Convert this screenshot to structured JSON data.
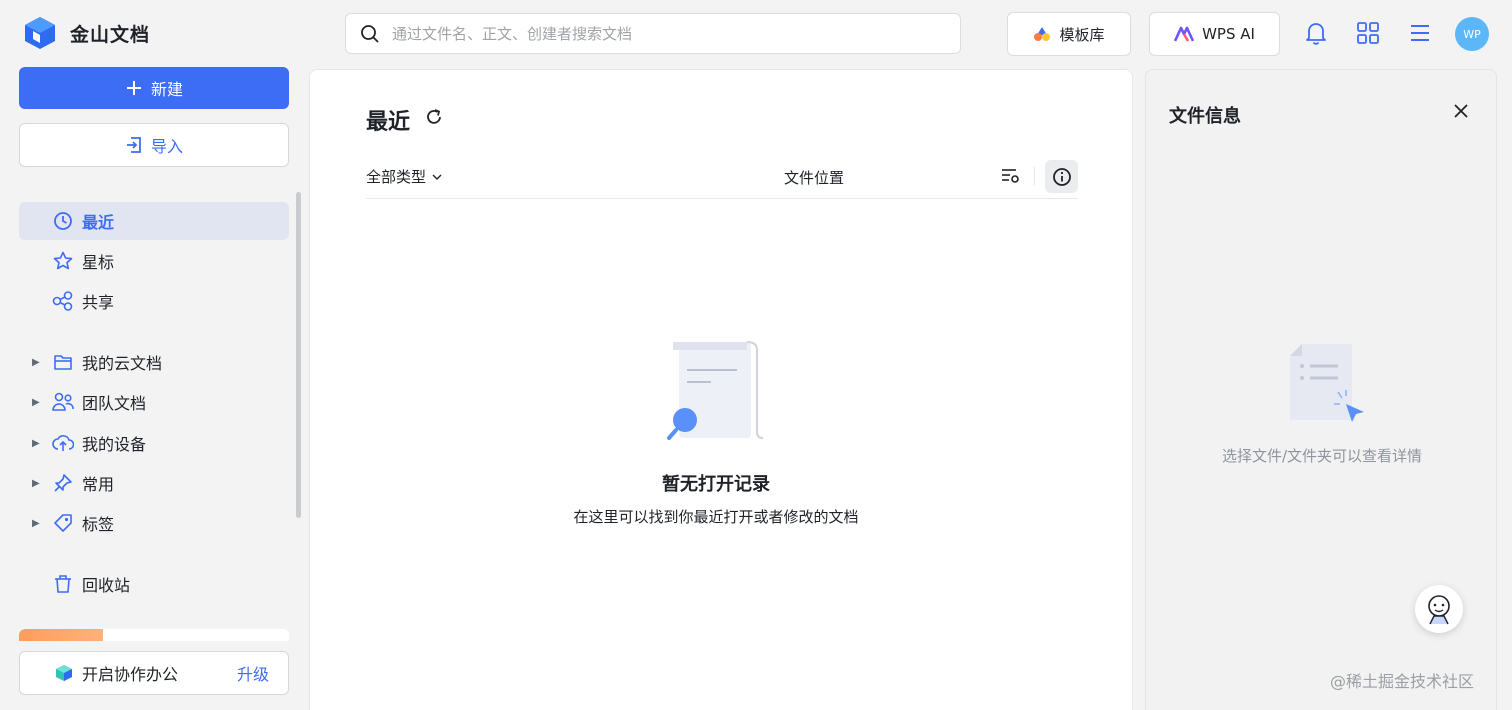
{
  "brand": {
    "name": "金山文档"
  },
  "search": {
    "placeholder": "通过文件名、正文、创建者搜索文档"
  },
  "topbar": {
    "template_label": "模板库",
    "ai_label": "WPS AI",
    "avatar_text": "WP"
  },
  "sidebar": {
    "new_label": "新建",
    "import_label": "导入",
    "quick": [
      {
        "label": "最近",
        "icon": "clock-icon",
        "active": true
      },
      {
        "label": "星标",
        "icon": "star-icon"
      },
      {
        "label": "共享",
        "icon": "share-icon"
      }
    ],
    "folders": [
      {
        "label": "我的云文档",
        "icon": "folder-icon"
      },
      {
        "label": "团队文档",
        "icon": "team-icon"
      },
      {
        "label": "我的设备",
        "icon": "cloud-device-icon"
      },
      {
        "label": "常用",
        "icon": "pin-icon"
      },
      {
        "label": "标签",
        "icon": "tag-icon"
      }
    ],
    "trash_label": "回收站",
    "upgrade": {
      "label": "开启协作办公",
      "link": "升级"
    }
  },
  "main": {
    "title": "最近",
    "filter_label": "全部类型",
    "column_location": "文件位置",
    "empty_title": "暂无打开记录",
    "empty_desc": "在这里可以找到你最近打开或者修改的文档"
  },
  "info_panel": {
    "title": "文件信息",
    "hint": "选择文件/文件夹可以查看详情"
  },
  "watermark": "@稀土掘金技术社区",
  "colors": {
    "accent": "#3e6df5",
    "active_bg": "#e1e5f2",
    "avatar": "#5bb7f7"
  }
}
